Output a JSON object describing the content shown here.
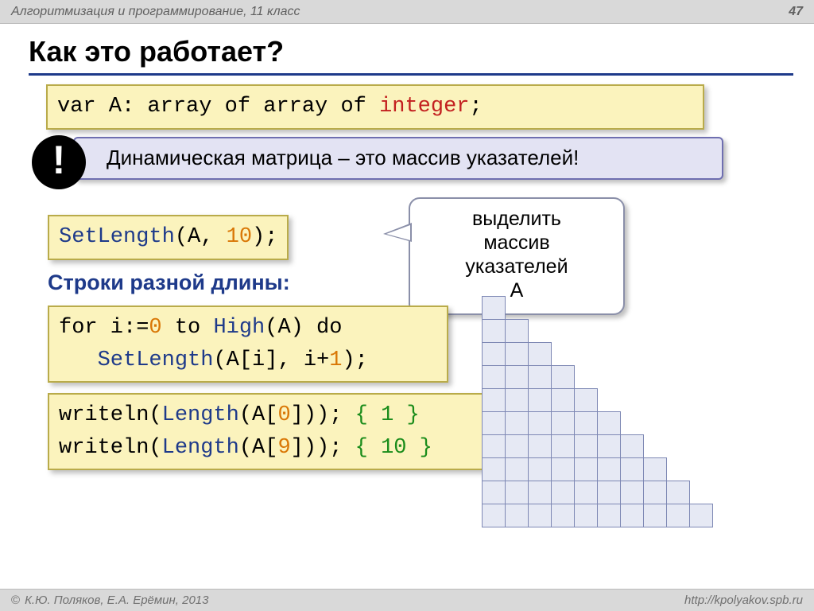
{
  "header": {
    "course": "Алгоритмизация и программирование, 11 класс",
    "page": "47"
  },
  "title": "Как это работает?",
  "code_decl": {
    "p1": "var A: array of array of ",
    "p2": "integer",
    "p3": ";"
  },
  "info": {
    "mark": "!",
    "text": "Динамическая матрица – это  массив указателей!"
  },
  "code_setlen": {
    "p1": "SetLength",
    "p2": "(A, ",
    "p3": "10",
    "p4": ");"
  },
  "callout": {
    "l1": "выделить",
    "l2": "массив",
    "l3": "указателей",
    "l4": "A"
  },
  "subheading": "Строки разной длины:",
  "code_for": {
    "a1": "for i:=",
    "a2": "0",
    "a3": " to ",
    "a4": "High",
    "a5": "(A) do",
    "b1": "   ",
    "b2": "SetLength",
    "b3": "(A[i], i+",
    "b4": "1",
    "b5": ");"
  },
  "code_write": {
    "a1": "writeln(",
    "a2": "Length",
    "a3": "(A[",
    "a4": "0",
    "a5": "])); ",
    "a6": "{ 1 }",
    "b1": "writeln(",
    "b2": "Length",
    "b3": "(A[",
    "b4": "9",
    "b5": "])); ",
    "b6": "{ 10 }"
  },
  "staircase_rows": 10,
  "footer": {
    "copyright": "©",
    "authors": "К.Ю. Поляков, Е.А. Ерёмин, 2013",
    "url": "http://kpolyakov.spb.ru"
  }
}
